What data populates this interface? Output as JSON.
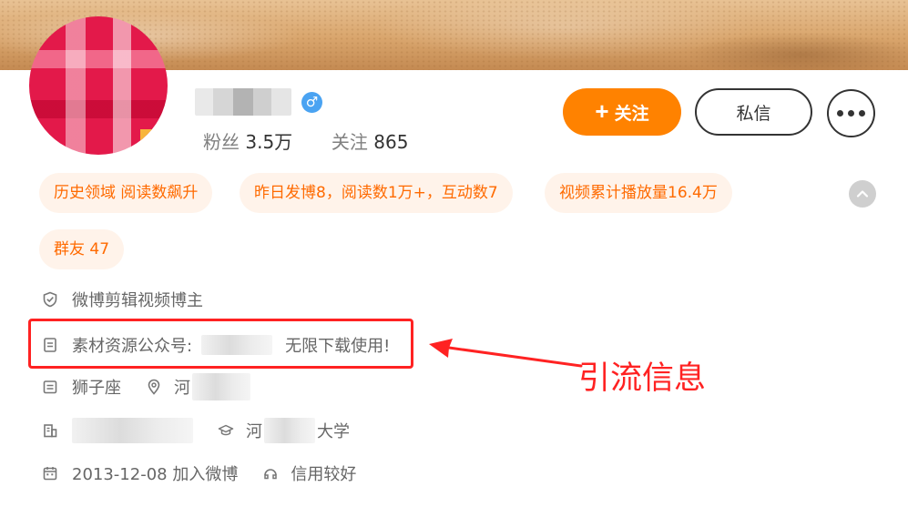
{
  "profile": {
    "gender_symbol": "♂",
    "fans_label": "粉丝",
    "fans_value": "3.5万",
    "following_label": "关注",
    "following_value": "865"
  },
  "actions": {
    "follow_plus": "+",
    "follow_label": "关注",
    "message_label": "私信"
  },
  "tags": [
    {
      "label": "历史领域 阅读数飙升"
    },
    {
      "label": "昨日发博8，阅读数1万+，互动数7"
    },
    {
      "label": "视频累计播放量16.4万"
    },
    {
      "label": "群友 47"
    }
  ],
  "collapse_symbol": "^",
  "info": {
    "verified": "微博剪辑视频博主",
    "bio_prefix": "素材资源公众号:",
    "bio_suffix": "无限下载使用!",
    "zodiac": "狮子座",
    "location_prefix": "河",
    "school_prefix": "河",
    "school_suffix": "大学",
    "join_date": "2013-12-08 加入微博",
    "credit": "信用较好"
  },
  "annotation": {
    "text": "引流信息",
    "color": "#ff2222"
  },
  "colors": {
    "accent": "#ff8200",
    "tag_text": "#ff6a00",
    "tag_bg": "#fff3ea",
    "verified_blue": "#4aa3f2"
  },
  "icons": [
    "shield-check-icon",
    "document-icon",
    "calendar-list-icon",
    "location-pin-icon",
    "building-icon",
    "graduation-cap-icon",
    "calendar-icon",
    "credit-icon",
    "more-icon",
    "plus-icon",
    "male-icon",
    "chevron-up-icon"
  ]
}
